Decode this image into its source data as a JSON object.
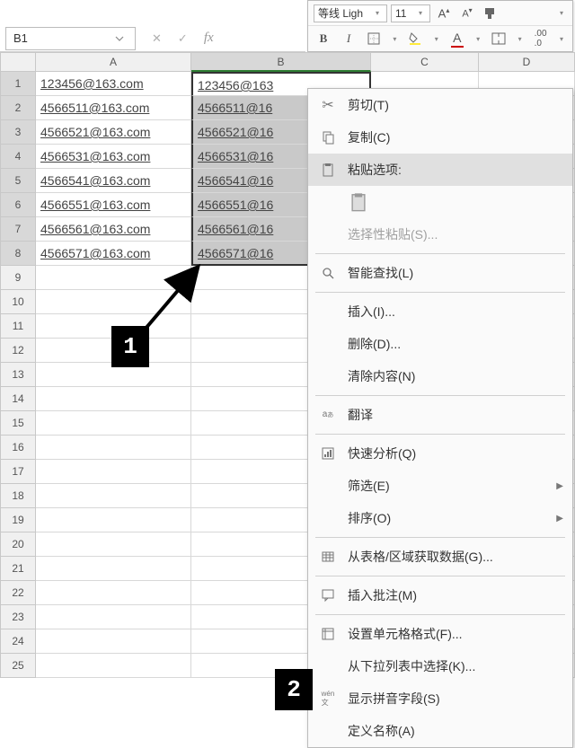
{
  "namebox": {
    "value": "B1"
  },
  "mini_toolbar": {
    "font_name": "等线 Ligh",
    "font_size": "11",
    "increase_font": "A",
    "decrease_font": "A",
    "bold": "B",
    "italic": "I"
  },
  "column_headers": [
    "A",
    "B",
    "C",
    "D"
  ],
  "row_headers": [
    "1",
    "2",
    "3",
    "4",
    "5",
    "6",
    "7",
    "8",
    "9",
    "10",
    "11",
    "12",
    "13",
    "14",
    "15",
    "16",
    "17",
    "18",
    "19",
    "20",
    "21",
    "22",
    "23",
    "24",
    "25"
  ],
  "cells": {
    "a": [
      "123456@163.com",
      "4566511@163.com",
      "4566521@163.com",
      "4566531@163.com",
      "4566541@163.com",
      "4566551@163.com",
      "4566561@163.com",
      "4566571@163.com"
    ],
    "b": [
      "123456@163",
      "4566511@16",
      "4566521@16",
      "4566531@16",
      "4566541@16",
      "4566551@16",
      "4566561@16",
      "4566571@16"
    ]
  },
  "context_menu": {
    "cut": "剪切(T)",
    "copy": "复制(C)",
    "paste_options": "粘贴选项:",
    "paste_special": "选择性粘贴(S)...",
    "smart_lookup": "智能查找(L)",
    "insert": "插入(I)...",
    "delete": "删除(D)...",
    "clear": "清除内容(N)",
    "translate": "翻译",
    "quick_analysis": "快速分析(Q)",
    "filter": "筛选(E)",
    "sort": "排序(O)",
    "get_from_range": "从表格/区域获取数据(G)...",
    "insert_comment": "插入批注(M)",
    "format_cells": "设置单元格格式(F)...",
    "pick_from_list": "从下拉列表中选择(K)...",
    "show_phonetic": "显示拼音字段(S)",
    "define_name": "定义名称(A)"
  },
  "badges": {
    "one": "1",
    "two": "2"
  }
}
